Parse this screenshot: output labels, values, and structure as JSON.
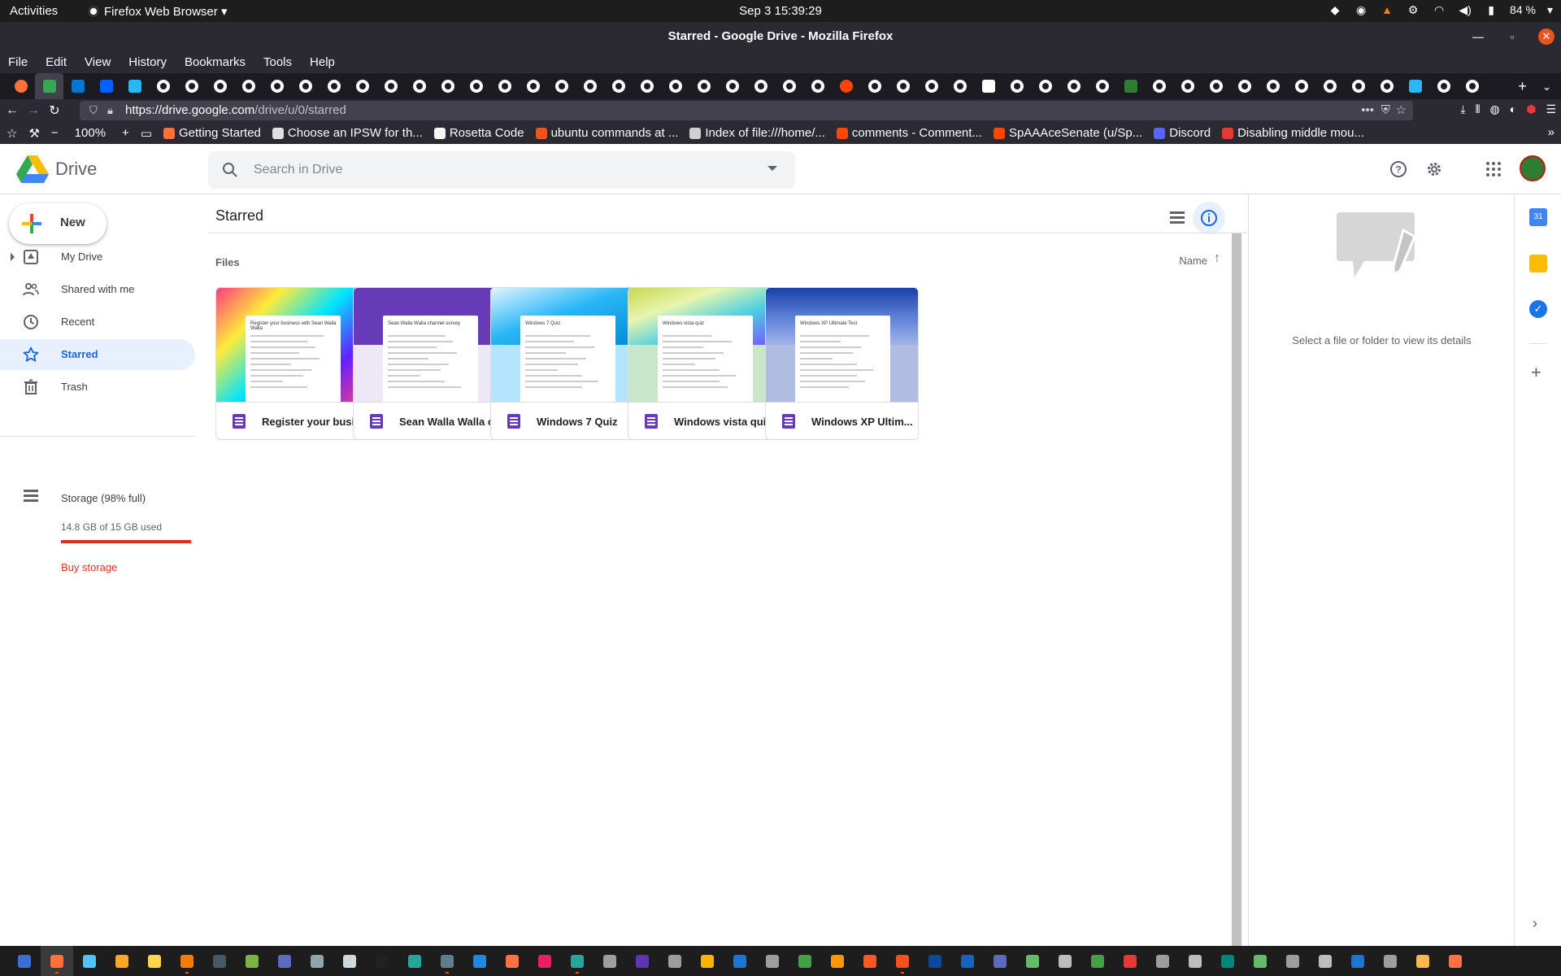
{
  "system_bar": {
    "activities": "Activities",
    "app_name": "Firefox Web Browser",
    "clock": "Sep 3  15:39:29",
    "battery": "84 %"
  },
  "window": {
    "title": "Starred - Google Drive - Mozilla Firefox"
  },
  "menu": {
    "file": "File",
    "edit": "Edit",
    "view": "View",
    "history": "History",
    "bookmarks": "Bookmarks",
    "tools": "Tools",
    "help": "Help"
  },
  "nav": {
    "url_host": "https://drive.google.com",
    "url_path": "/drive/u/0/starred",
    "zoom": "100%"
  },
  "bookmarks": [
    {
      "label": "Getting Started",
      "color": "#ff7139"
    },
    {
      "label": "Choose an IPSW for th...",
      "color": "#e0e0e0"
    },
    {
      "label": "Rosetta Code",
      "color": "#f5f5f5"
    },
    {
      "label": "ubuntu commands at ...",
      "color": "#e95420"
    },
    {
      "label": "Index of file:///home/...",
      "color": "#d0d0d0"
    },
    {
      "label": "comments - Comment...",
      "color": "#ff4500"
    },
    {
      "label": "SpAAAceSenate (u/Sp...",
      "color": "#ff4500"
    },
    {
      "label": "Discord",
      "color": "#5865f2"
    },
    {
      "label": "Disabling middle mou...",
      "color": "#e53935"
    }
  ],
  "drive": {
    "logo_text": "Drive",
    "search_placeholder": "Search in Drive",
    "new_label": "New",
    "nav_items": [
      {
        "label": "My Drive",
        "icon": "my-drive-icon"
      },
      {
        "label": "Shared with me",
        "icon": "shared-icon"
      },
      {
        "label": "Recent",
        "icon": "clock-icon"
      },
      {
        "label": "Starred",
        "icon": "star-icon",
        "active": true
      },
      {
        "label": "Trash",
        "icon": "trash-icon"
      }
    ],
    "storage_label": "Storage (98% full)",
    "storage_used": "14.8 GB of 15 GB used",
    "storage_fraction": 0.987,
    "buy_storage": "Buy storage",
    "page_title": "Starred",
    "files_label": "Files",
    "sort_label": "Name",
    "details_message": "Select a file or folder to view its details",
    "files": [
      {
        "name": "Register your busi...",
        "doc_title": "Register your business with Sean Walla Walla",
        "bg": "linear-gradient(135deg,#ff3d7f 0%,#ffeb3b 25%,#00e5ff 50%,#651fff 75%,#ff4081 100%)",
        "bottom": "#d9e3ea"
      },
      {
        "name": "Sean Walla Walla c...",
        "doc_title": "Sean Walla Walla channel survey",
        "bg": "#673ab7",
        "bottom": "#ede7f6"
      },
      {
        "name": "Windows 7 Quiz",
        "doc_title": "Windows 7 Quiz",
        "bg": "linear-gradient(160deg,#e1f5fe 0%,#29b6f6 45%,#0288d1 100%)",
        "bottom": "#b3e5fc"
      },
      {
        "name": "Windows vista qui...",
        "doc_title": "Windows vista quiz",
        "bg": "linear-gradient(160deg,#c6d84a 0%,#e8f5b0 30%,#4dd0e1 60%,#7c4dff 100%)",
        "bottom": "#c8e6c9"
      },
      {
        "name": "Windows XP Ultim...",
        "doc_title": "Windows XP Ultimate Test",
        "bg": "linear-gradient(180deg,#1a3fa8 0%,#5c7fd6 50%,#9fb4e8 100%)",
        "bottom": "#b0bce2"
      }
    ]
  }
}
